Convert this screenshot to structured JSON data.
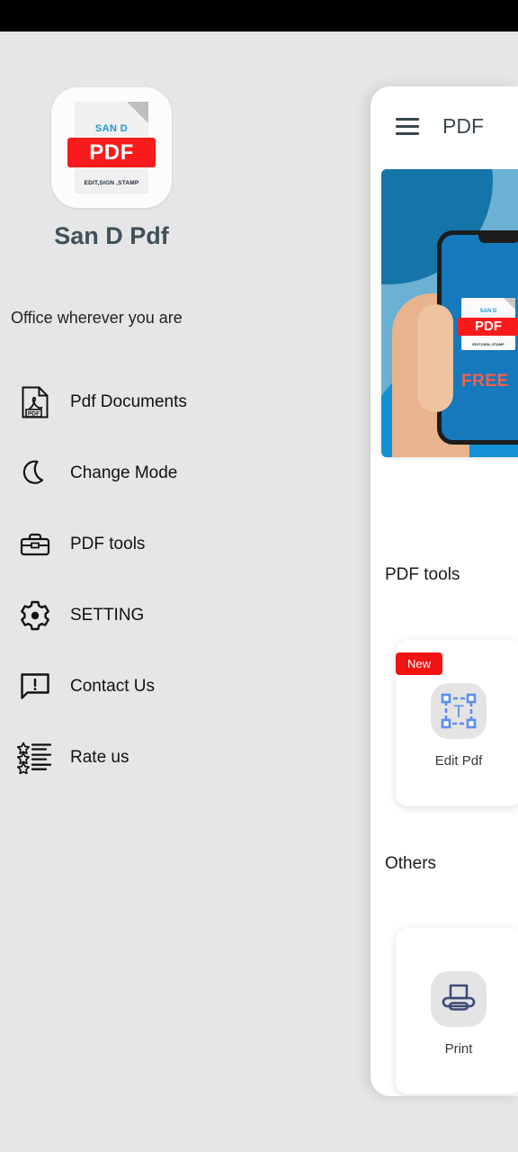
{
  "window": {
    "status_bar_color": "#000000",
    "background_color": "#e6e6e6"
  },
  "drawer": {
    "app_icon": {
      "icon_name": "san-d-pdf-app-icon",
      "brand_top": "SAN D",
      "brand_main": "PDF",
      "brand_tagline": "EDIT,SIGN ,STAMP",
      "accent_red": "#f91b1b",
      "accent_blue": "#2196d6"
    },
    "app_title": "San D Pdf",
    "tagline": "Office wherever you are",
    "items": [
      {
        "label": "Pdf Documents",
        "icon": "pdf-file-icon"
      },
      {
        "label": "Change Mode",
        "icon": "moon-icon"
      },
      {
        "label": "PDF tools",
        "icon": "toolbox-icon"
      },
      {
        "label": "SETTING",
        "icon": "gear-icon"
      },
      {
        "label": "Contact Us",
        "icon": "message-alert-icon"
      },
      {
        "label": "Rate us",
        "icon": "star-list-icon"
      }
    ]
  },
  "panel": {
    "appbar": {
      "menu_icon": "hamburger-menu-icon",
      "title": "PDF"
    },
    "banner": {
      "icon_name": "promo-banner-hand-holding-phone",
      "brand_top": "SAN D",
      "brand_main": "PDF",
      "brand_tagline": "EDIT,SIGN ,STAMP",
      "headline": "FREE",
      "bg_light_blue": "#6cb0d4",
      "bg_dark_blue": "#1675a8",
      "bg_accent_blue": "#1390d6"
    },
    "sections": [
      {
        "title": "PDF tools",
        "cards": [
          {
            "label": "Edit Pdf",
            "icon": "edit-text-box-icon",
            "badge": "New",
            "badge_color": "#f21313",
            "icon_color": "#5b8def"
          }
        ]
      },
      {
        "title": "Others",
        "cards": [
          {
            "label": "Print",
            "icon": "printer-icon",
            "icon_color": "#3d4a77"
          }
        ]
      }
    ]
  }
}
